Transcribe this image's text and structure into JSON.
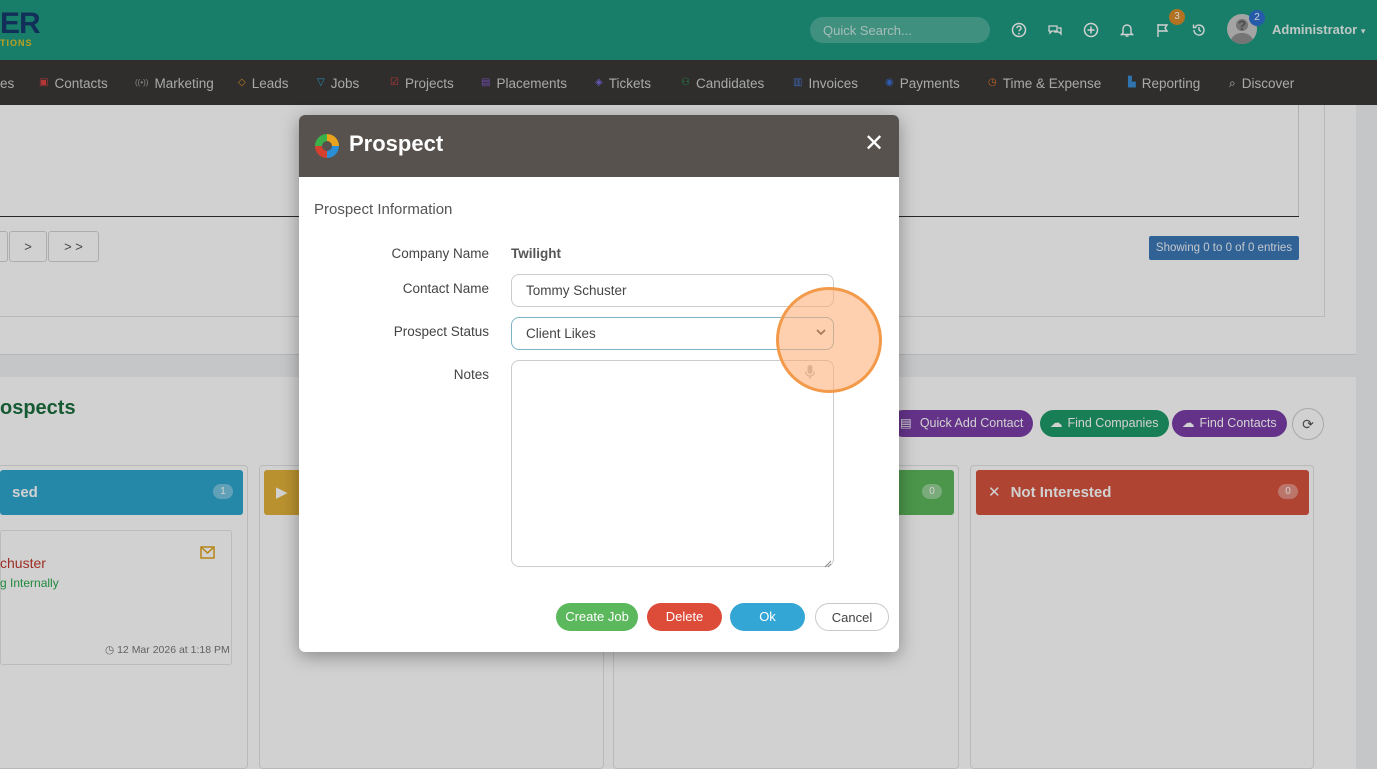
{
  "header": {
    "logo_text": "ER",
    "logo_sub": "TIONS",
    "search_placeholder": "Quick Search...",
    "icons": [
      "help-icon",
      "chat-icon",
      "plus-circle-icon",
      "bell-icon",
      "flag-icon",
      "history-icon"
    ],
    "flag_badge": "3",
    "avatar_badge": "2",
    "user_name": "Administrator",
    "colors": {
      "bar": "#1e9a82",
      "flag_badge": "#d88c2a",
      "avatar_badge": "#2f6fd0"
    }
  },
  "nav": {
    "items": [
      {
        "label": "es",
        "icon": ""
      },
      {
        "label": "Contacts",
        "icon": "▣"
      },
      {
        "label": "Marketing",
        "icon": "((•))"
      },
      {
        "label": "Leads",
        "icon": "◇"
      },
      {
        "label": "Jobs",
        "icon": "▽"
      },
      {
        "label": "Projects",
        "icon": "☑"
      },
      {
        "label": "Placements",
        "icon": "▤"
      },
      {
        "label": "Tickets",
        "icon": "◈"
      },
      {
        "label": "Candidates",
        "icon": "⚇"
      },
      {
        "label": "Invoices",
        "icon": "▥"
      },
      {
        "label": "Payments",
        "icon": "◉"
      },
      {
        "label": "Time & Expense",
        "icon": "◷"
      },
      {
        "label": "Reporting",
        "icon": "▙"
      },
      {
        "label": "Discover",
        "icon": "⌕"
      }
    ]
  },
  "background": {
    "pager": [
      ">",
      "> >"
    ],
    "showing_text": "Showing 0 to 0 of 0 entries",
    "prospects_title": "ospects",
    "buttons": [
      {
        "label": "Quick Add Contact",
        "icon": "▤",
        "color": "#7b3fa8"
      },
      {
        "label": "Find Companies",
        "icon": "☁",
        "color": "#1e9a6a"
      },
      {
        "label": "Find Contacts",
        "icon": "☁",
        "color": "#7b3fa8"
      }
    ],
    "columns": [
      {
        "title": "sed",
        "count": "1",
        "color": "#2fa6cf"
      },
      {
        "title": "",
        "count": "",
        "color": "#e2b23a"
      },
      {
        "title": "",
        "count": "0",
        "color": "#5cb85c"
      },
      {
        "title": "Not Interested",
        "count": "0",
        "color": "#d6533f"
      }
    ],
    "card": {
      "name": "chuster",
      "status": "g Internally",
      "date": "12 Mar 2026 at 1:18 PM"
    }
  },
  "modal": {
    "title": "Prospect",
    "section_title": "Prospect Information",
    "fields": {
      "company_label": "Company Name",
      "company_value": "Twilight",
      "contact_label": "Contact Name",
      "contact_value": "Tommy Schuster",
      "status_label": "Prospect Status",
      "status_value": "Client Likes",
      "notes_label": "Notes",
      "notes_value": ""
    },
    "buttons": {
      "create_job": "Create Job",
      "delete": "Delete",
      "ok": "Ok",
      "cancel": "Cancel"
    }
  }
}
